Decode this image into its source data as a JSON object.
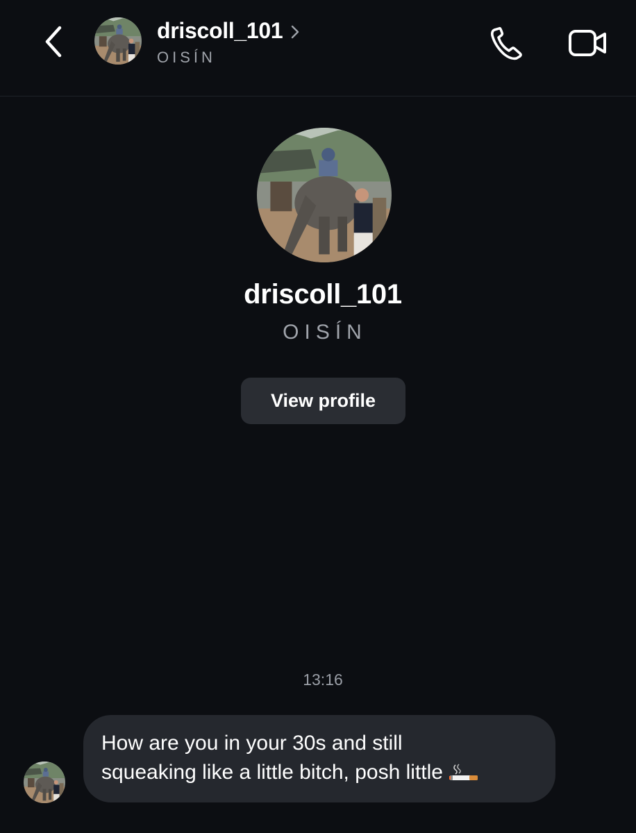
{
  "header": {
    "username": "driscoll_101",
    "subtitle": "OISÍN"
  },
  "profile": {
    "username": "driscoll_101",
    "subtitle": "OISÍN",
    "view_profile_label": "View profile"
  },
  "conversation": {
    "timestamp": "13:16",
    "messages": [
      {
        "sender": "driscoll_101",
        "text": "How are you in your 30s and still\nsqueaking like a little bitch, posh little",
        "trailing_emoji": "cigarette-emoji"
      }
    ]
  },
  "colors": {
    "background": "#0c0e12",
    "bubble": "#25282e",
    "button": "#2a2d33",
    "muted_text": "#a0a4ab"
  },
  "icons": [
    "back-arrow-icon",
    "chevron-right-icon",
    "phone-icon",
    "video-camera-icon"
  ]
}
